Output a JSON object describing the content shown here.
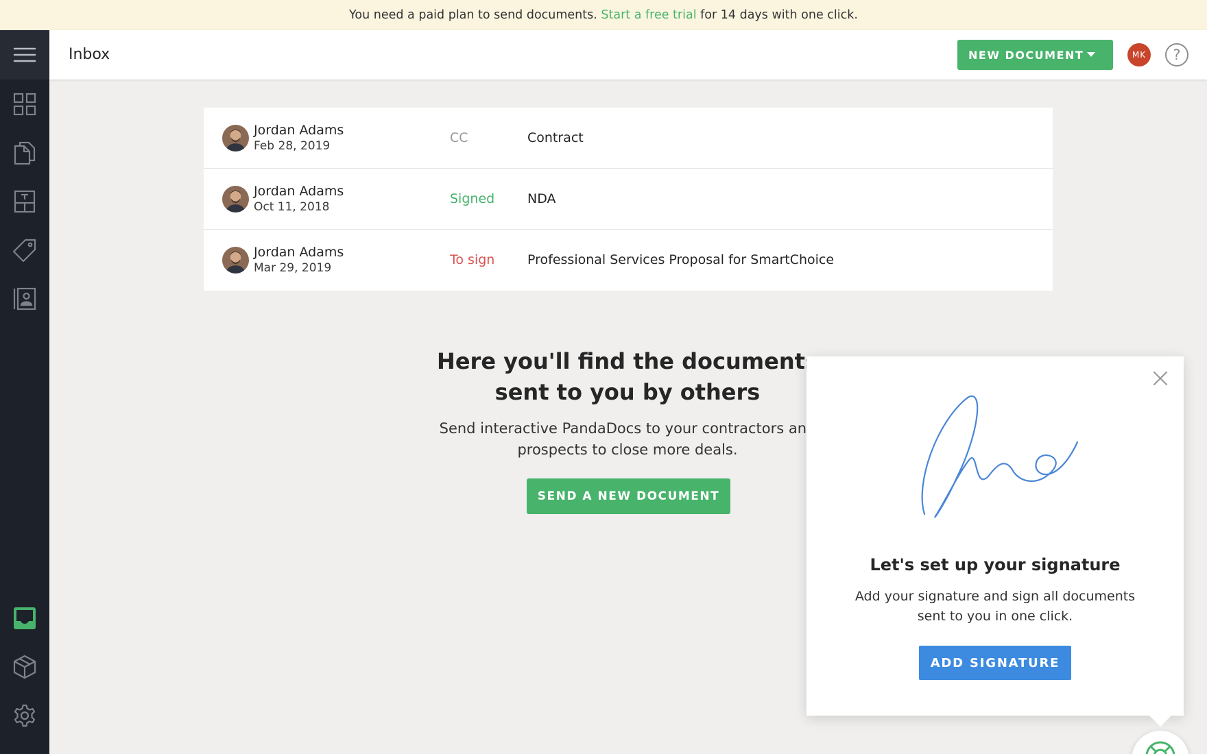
{
  "banner": {
    "prefix": "You need a paid plan to send documents.",
    "link": "Start a free trial",
    "suffix": "for 14 days with one click."
  },
  "sidebar": {
    "items": [
      {
        "icon": "hamburger-menu-icon"
      },
      {
        "icon": "dashboard-grid-icon"
      },
      {
        "icon": "documents-icon"
      },
      {
        "icon": "templates-icon"
      },
      {
        "icon": "catalog-tag-icon"
      },
      {
        "icon": "contacts-icon"
      },
      {
        "icon": "inbox-icon",
        "active": true
      },
      {
        "icon": "integrations-cube-icon"
      },
      {
        "icon": "settings-gear-icon"
      }
    ],
    "active_color": "#47b36b"
  },
  "header": {
    "title": "Inbox",
    "new_document": "NEW DOCUMENT",
    "user_initials": "MK",
    "help": "?"
  },
  "documents": [
    {
      "sender": "Jordan Adams",
      "date": "Feb 28, 2019",
      "status": "CC",
      "title": "Contract"
    },
    {
      "sender": "Jordan Adams",
      "date": "Oct 11, 2018",
      "status": "Signed",
      "title": "NDA"
    },
    {
      "sender": "Jordan Adams",
      "date": "Mar 29, 2019",
      "status": "To sign",
      "title": "Professional Services Proposal for SmartChoice"
    }
  ],
  "empty_state": {
    "title_line1": "Here you'll find the documents",
    "title_line2": "sent to you by others",
    "desc_line1": "Send interactive PandaDocs to your contractors and",
    "desc_line2": "prospects to close more deals.",
    "button": "SEND A NEW DOCUMENT"
  },
  "signature_popup": {
    "title": "Let's set up your signature",
    "desc_line1": "Add your signature and sign all documents",
    "desc_line2": "sent to you in one click.",
    "button": "ADD SIGNATURE"
  },
  "colors": {
    "brand_green": "#47b36b",
    "to_sign_red": "#d9534f",
    "signature_blue": "#3d8be0",
    "sidebar_bg": "#1d2129"
  }
}
